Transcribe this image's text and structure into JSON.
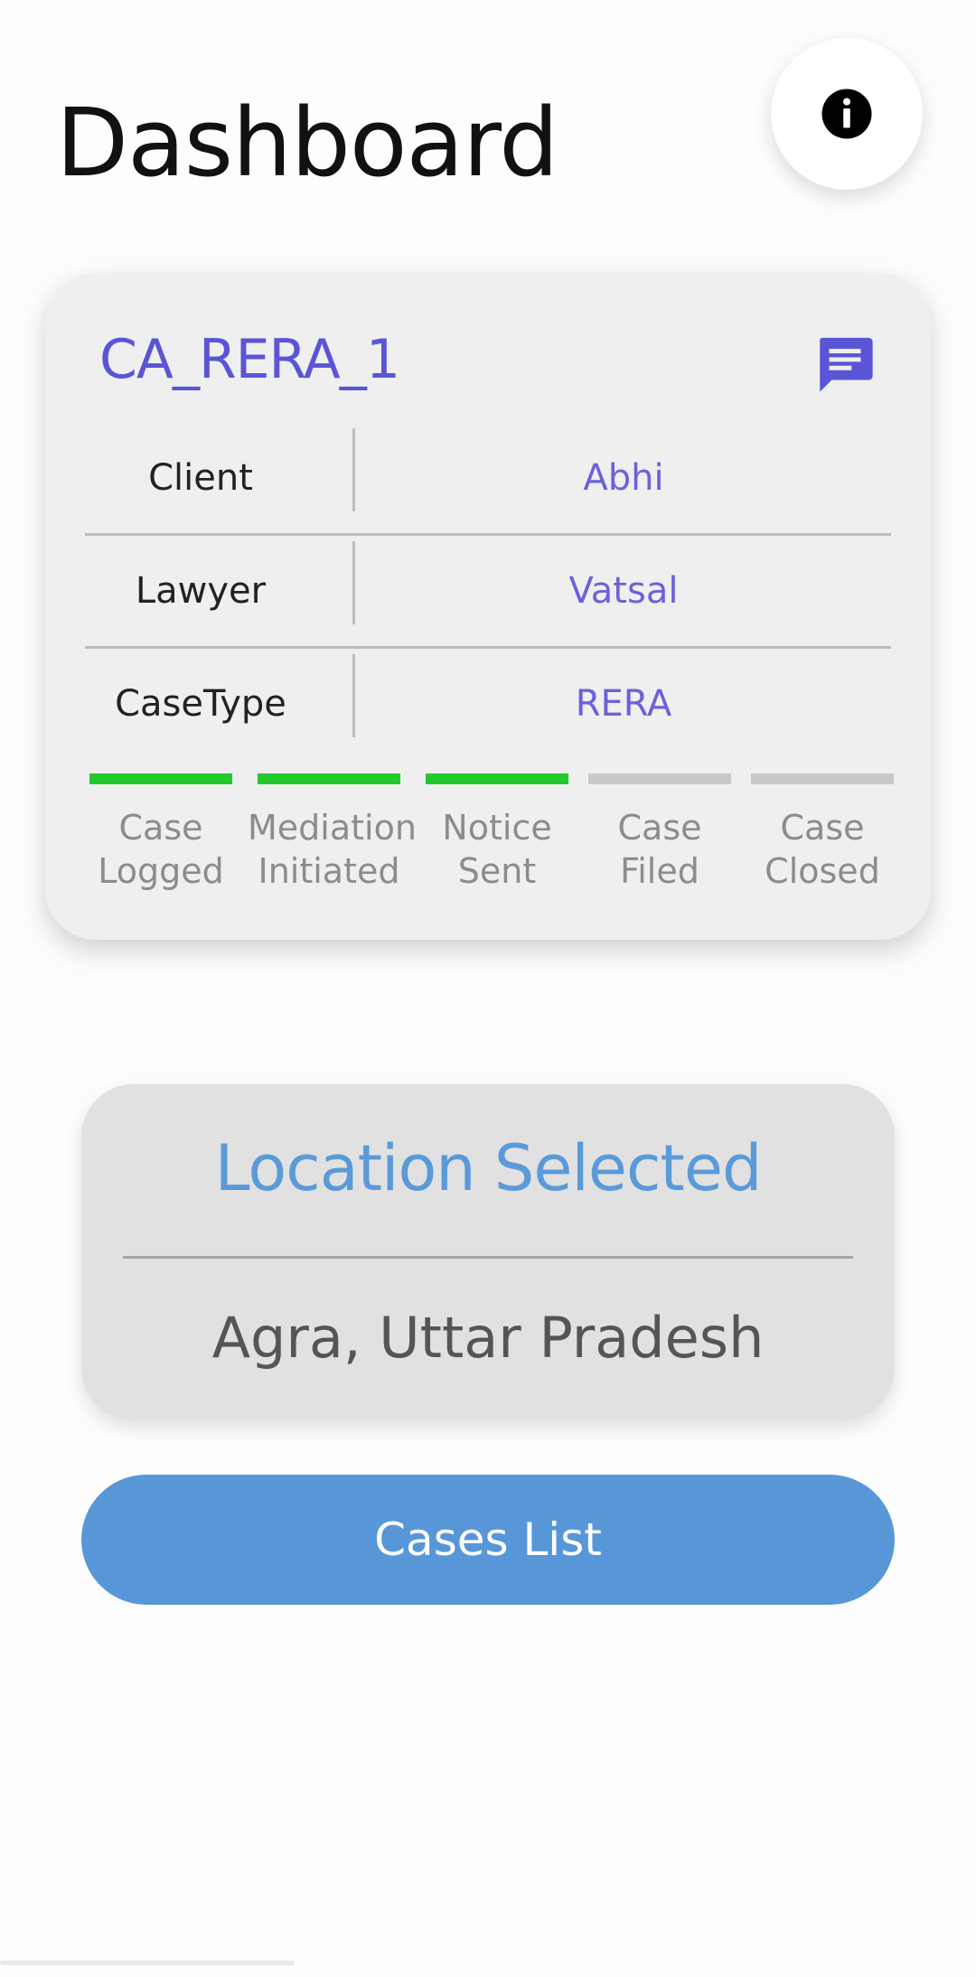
{
  "header": {
    "title": "Dashboard"
  },
  "info_button": {
    "icon": "info-icon"
  },
  "case": {
    "id": "CA_RERA_1",
    "chat_icon": "chat-icon",
    "rows": [
      {
        "key": "Client",
        "value": "Abhi"
      },
      {
        "key": "Lawyer",
        "value": "Vatsal"
      },
      {
        "key": "CaseType",
        "value": "RERA"
      }
    ],
    "steps": [
      {
        "line1": "Case",
        "line2": "Logged",
        "done": true
      },
      {
        "line1": "Mediation",
        "line2": "Initiated",
        "done": true
      },
      {
        "line1": "Notice",
        "line2": "Sent",
        "done": true
      },
      {
        "line1": "Case",
        "line2": "Filed",
        "done": false
      },
      {
        "line1": "Case",
        "line2": "Closed",
        "done": false
      }
    ]
  },
  "location": {
    "title": "Location Selected",
    "value": "Agra, Uttar Pradesh"
  },
  "cases_button": {
    "label": "Cases List"
  },
  "colors": {
    "accent_purple": "#5a55d6",
    "accent_blue": "#5797d8",
    "progress_done": "#22c92b",
    "progress_todo": "#c9c9c9"
  }
}
